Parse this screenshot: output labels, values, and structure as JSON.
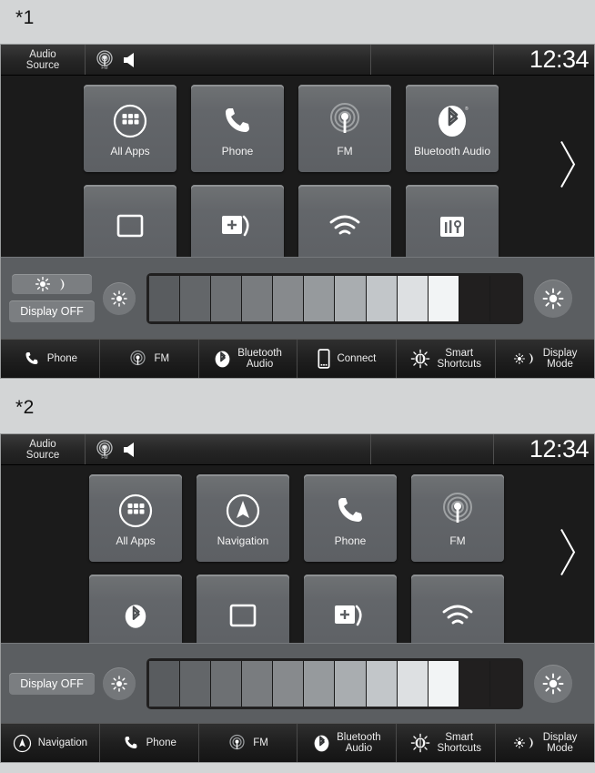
{
  "figures": {
    "one_label": "*1",
    "two_label": "*2"
  },
  "colors": {
    "page_background": "#d3d5d6",
    "screen_background": "#1b1b1b",
    "tile_face": "#63666a",
    "tile_highlight": "#8e9193",
    "control_panel": "#5b5e61",
    "pill_background": "#7b7e81",
    "text_primary": "#f2f2f2",
    "slider_track": "#201f1f"
  },
  "panel1": {
    "statusbar": {
      "audio_source_line1": "Audio",
      "audio_source_line2": "Source",
      "radio_icon": "fm-radio-icon",
      "radio_icon_label": "FM",
      "volume_icon": "speaker-volume-icon",
      "clock": "12:34"
    },
    "grid": {
      "row1": [
        {
          "label": "All Apps",
          "icon": "all-apps-grid-icon"
        },
        {
          "label": "Phone",
          "icon": "phone-handset-icon"
        },
        {
          "label": "FM",
          "icon": "fm-radio-icon"
        },
        {
          "label": "Bluetooth\nAudio",
          "icon": "bluetooth-icon"
        }
      ],
      "row2": [
        {
          "label": "",
          "icon": "rear-camera-icon"
        },
        {
          "label": "",
          "icon": "sms-message-icon"
        },
        {
          "label": "",
          "icon": "wifi-icon"
        },
        {
          "label": "",
          "icon": "info-trip-icon"
        }
      ],
      "next_page_icon": "chevron-right-icon"
    },
    "controls": {
      "day_night_toggle_label": "day-night-toggle",
      "sun_icon": "sun-icon",
      "moon_icon": "moon-icon",
      "display_off_label": "Display OFF",
      "brightness_down_icon": "brightness-small-sun-icon",
      "brightness_up_icon": "brightness-large-sun-icon",
      "slider_segments": 10,
      "slider_filled": 10,
      "slider_empty": 2
    },
    "bottombar": [
      {
        "label": "Phone",
        "icon": "phone-handset-icon"
      },
      {
        "label": "FM",
        "icon": "fm-radio-icon"
      },
      {
        "label": "Bluetooth\nAudio",
        "icon": "bluetooth-icon"
      },
      {
        "label": "Connect",
        "icon": "smartphone-icon"
      },
      {
        "label": "Smart\nShortcuts",
        "icon": "smart-shortcuts-icon"
      },
      {
        "label": "Display\nMode",
        "icon": "display-mode-icon"
      }
    ]
  },
  "panel2": {
    "statusbar": {
      "audio_source_line1": "Audio",
      "audio_source_line2": "Source",
      "radio_icon": "fm-radio-icon",
      "radio_icon_label": "FM",
      "volume_icon": "speaker-volume-icon",
      "clock": "12:34"
    },
    "grid": {
      "row1": [
        {
          "label": "All Apps",
          "icon": "all-apps-grid-icon"
        },
        {
          "label": "Navigation",
          "icon": "navigation-compass-icon"
        },
        {
          "label": "Phone",
          "icon": "phone-handset-icon"
        },
        {
          "label": "FM",
          "icon": "fm-radio-icon"
        }
      ],
      "row2": [
        {
          "label": "",
          "icon": "bluetooth-icon"
        },
        {
          "label": "",
          "icon": "rear-camera-icon"
        },
        {
          "label": "",
          "icon": "sms-message-icon"
        },
        {
          "label": "",
          "icon": "wifi-icon"
        }
      ],
      "next_page_icon": "chevron-right-icon"
    },
    "controls": {
      "display_off_label": "Display OFF",
      "brightness_down_icon": "brightness-small-sun-icon",
      "brightness_up_icon": "brightness-large-sun-icon",
      "slider_segments": 10,
      "slider_filled": 10,
      "slider_empty": 2
    },
    "bottombar": [
      {
        "label": "Navigation",
        "icon": "navigation-compass-icon"
      },
      {
        "label": "Phone",
        "icon": "phone-handset-icon"
      },
      {
        "label": "FM",
        "icon": "fm-radio-icon"
      },
      {
        "label": "Bluetooth\nAudio",
        "icon": "bluetooth-icon"
      },
      {
        "label": "Smart\nShortcuts",
        "icon": "smart-shortcuts-icon"
      },
      {
        "label": "Display\nMode",
        "icon": "display-mode-icon"
      }
    ]
  }
}
